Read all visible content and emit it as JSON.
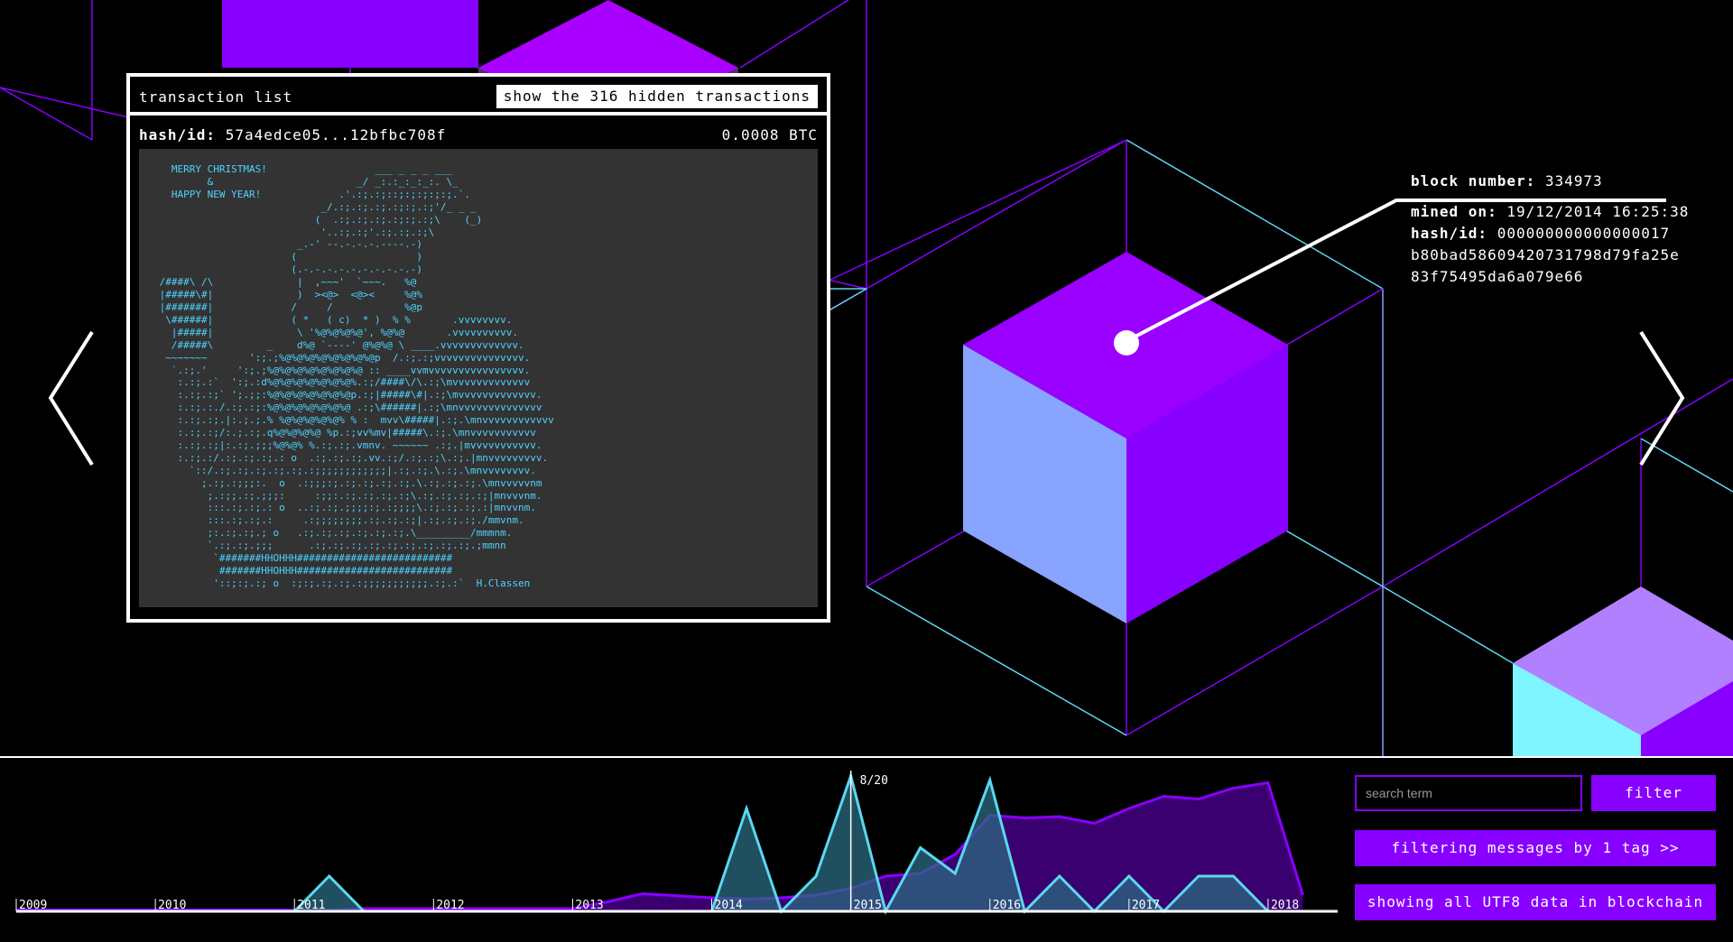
{
  "transaction_panel": {
    "title": "transaction list",
    "show_hidden_label": "show the 316 hidden transactions",
    "tx_hash_label": "hash/id:",
    "tx_hash_value": "57a4edce05...12bfbc708f",
    "tx_amount": "0.0008 BTC",
    "ascii_lines": [
      "   MERRY CHRISTMAS!                  ___ _ _ _ ___",
      "         &                        _/ _:.:_:_:_:. \\_",
      "   HAPPY NEW YEAR!             .'.:;.:;::;:;:;:;:;.`.",
      "                            _/.:;.:;.:;.:;:;.:;'/_ _ _",
      "                           (  .:;.:;.:;.:;:;.:;\\    (_)",
      "                            '..:;.:;'.:;.:;.:;\\",
      "                        _.-' --.-.-.-.----.-)",
      "                       (                    )",
      "                       (.-.-.-.-.-.-.-.-.-.-)",
      " /####\\ /\\              |  ,~~~'  `~~~.   %@",
      " |#####\\#|              )  ><@>  <@><     %@%",
      " |#######|             /     /            %@p",
      "  \\######|             ( *   ( c)  * )  % %       .vvvvvvvv.",
      "   |#####|              \\ '%@%@%@%@', %@%@       .vvvvvvvvvv.",
      "   /#####\\         _    d%@ `----' @%@%@ \\ ____.vvvvvvvvvvvvv.",
      "  ~~~~~~~       ':;.;%@%@%@%@%@%@%@%@p  /.:;.:;vvvvvvvvvvvvvvv.",
      "   `.:;.'     ':;.;%@%@%@%@%@%@%@%@ :: ____vvmvvvvvvvvvvvvvvvv.",
      "    :.:;.:`  ':;.:d%@%@%@%@%@%@%@%.:;/####\\/\\.:;\\mvvvvvvvvvvvvv",
      "    :.:;.:;` ';.;;:%@%@%@%@%@%@%@p.:;|#####\\#|.:;\\mvvvvvvvvvvvvv.",
      "    :.:;.:./.:;.:;:%@%@%@%@%@%@%@ .:;\\######|.:;\\mnvvvvvvvvvvvvvv",
      "    :.:;.:;.|:.;.;.% %@%@%@%@%@% % :  mvv\\#####|.:;.\\mnvvvvvvvvvvvv",
      "    :.:;.:;/:.;.:;.q%@%@%@%@ %p.:;vv%mv|#####\\.:;.\\mnvvvvvvvvvvv",
      "    :.:;.:;|:.:;.;;;%@%@% %.:;.:;.vmnv. ~~~~~~ .:;.|mvvvvvvvvvvv.",
      "    :.:;.:/.:;.:;.:;.: o  .:;.:;.:;.vv.:;/.:;.:;\\.:;.|mnvvvvvvvvv.",
      "      `::/.:;.:;.:;.:;.:;.:;;;;;;;;;;;;|.:;.:;.\\.:;.\\mnvvvvvvvv.",
      "        ;.:;.:;;;:.  o  .:;;;:;.:;.:;.:;.:;.\\.:;.:;.:;.\\mnvvvvvnm",
      "         ;.:;;.:;.;;;:     :;;:.:;.:;.:;.:;\\.:;.:;.:;.:;|mnvvvnm.",
      "         :::.:;.:;.: o  ..:;.:;.;;;;:;.:;;;;\\.:;.:;.:;.:|mnvvnm.",
      "         :::.:;.:;.:     .:;;;;;;;;.:;.:;.:;|.:;.:;.:;./mmvnm.",
      "         ;:.:;.:;.; o   .:;.:;.:;.:;.:;.:;.\\_________/mmmnm.",
      "         `.:;.:;.;;;      .:;.:;.:;.:;.:;.:;.:;.:;.:;.;mmnn",
      "          `#######HHOHHH##########################",
      "           #######HHOHHH##########################",
      "          '::;:;.:; o  :;:;.:;.:;.:;;;;;;;;;;;.:;.:`  H.Classen"
    ]
  },
  "block_info": {
    "block_number_label": "block number:",
    "block_number_value": "334973",
    "mined_on_label": "mined on:",
    "mined_on_value": "19/12/2014 16:25:38",
    "hash_label": "hash/id:",
    "hash_line1": "000000000000000017",
    "hash_line2": "b80bad58609420731798d79fa25e",
    "hash_line3": "83f75495da6a079e66"
  },
  "navigation": {
    "prev_icon": "chevron-left-icon",
    "next_icon": "chevron-right-icon"
  },
  "controls": {
    "search_placeholder": "search term",
    "filter_label": "filter",
    "tag_filter_label": "filtering messages by 1 tag >>",
    "utf8_label": "showing all UTF8 data in blockchain"
  },
  "colors": {
    "background": "#000000",
    "accent_purple": "#8800ff",
    "cube_light": "#88a4ff",
    "cyan": "#5ad8f0",
    "area_purple": "#3a0070"
  },
  "chart_data": {
    "type": "area",
    "x": [
      "2009",
      "2009.5",
      "2010",
      "2010.5",
      "2011",
      "2011.25",
      "2011.5",
      "2012",
      "2012.5",
      "2013",
      "2013.25",
      "2013.5",
      "2014",
      "2014.25",
      "2014.5",
      "2014.75",
      "2015",
      "2015.25",
      "2015.5",
      "2015.75",
      "2016",
      "2016.25",
      "2016.5",
      "2016.75",
      "2017",
      "2017.25",
      "2017.5",
      "2017.75",
      "2018",
      "2018.25"
    ],
    "x_tick_labels": [
      "2009",
      "2010",
      "2011",
      "2012",
      "2013",
      "2014",
      "2015",
      "2016",
      "2017",
      "2018"
    ],
    "cursor_label": "8/20",
    "cursor_x": 2015,
    "series": [
      {
        "color": "#8800ff",
        "values": [
          1,
          1,
          1,
          1,
          1,
          1,
          2,
          2,
          2,
          2,
          7,
          13,
          10,
          9,
          10,
          12,
          17,
          26,
          28,
          42,
          71,
          69,
          70,
          65,
          76,
          85,
          83,
          91,
          95,
          12
        ]
      },
      {
        "color": "#5ad8f0",
        "values": [
          0,
          0,
          0,
          0,
          0,
          26,
          0,
          0,
          0,
          0,
          0,
          0,
          0,
          76,
          0,
          26,
          100,
          0,
          47,
          28,
          97,
          0,
          26,
          0,
          26,
          0,
          26,
          26,
          0,
          0
        ]
      }
    ],
    "ylim": [
      0,
      100
    ]
  }
}
